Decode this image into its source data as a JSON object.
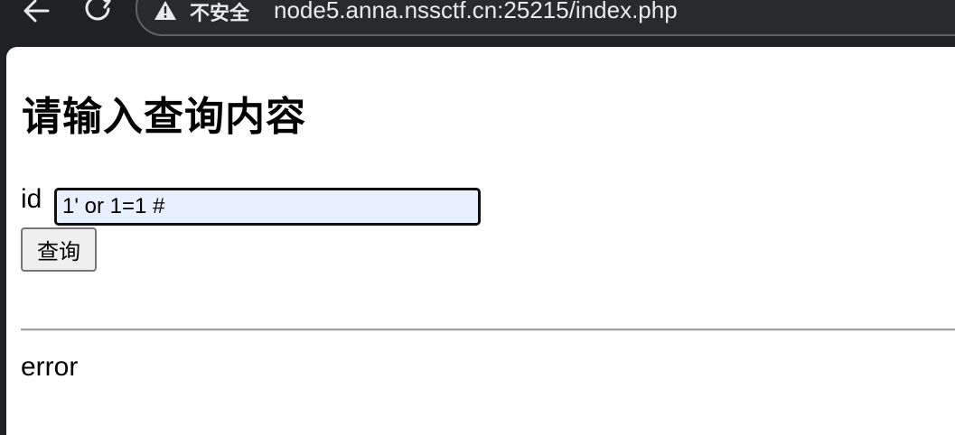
{
  "browser": {
    "security_label": "不安全",
    "url": "node5.anna.nssctf.cn:25215/index.php",
    "icons": {
      "back": "arrow-left-icon",
      "reload": "reload-icon",
      "security": "warning-triangle-icon"
    }
  },
  "page": {
    "heading": "请输入查询内容",
    "form": {
      "id_label": "id",
      "id_value": "1' or 1=1 #",
      "submit_label": "查询"
    },
    "result": "error"
  },
  "colors": {
    "browser_bg": "#202124",
    "input_autofill_bg": "#e8f0fe",
    "page_bg": "#ffffff"
  }
}
